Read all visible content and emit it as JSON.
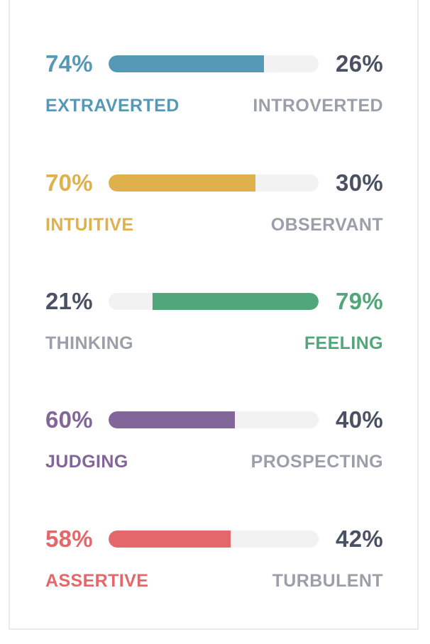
{
  "colors": {
    "neutral_text": "#4a5163",
    "neutral_label": "#9a9fa9",
    "track": "#f2f2f3",
    "card_border": "#e9eaec"
  },
  "traits": [
    {
      "left_percent": "74%",
      "right_percent": "26%",
      "left_label": "EXTRAVERTED",
      "right_label": "INTROVERTED",
      "dominant": "left",
      "fill_percent": 74,
      "color": "#5699b6"
    },
    {
      "left_percent": "70%",
      "right_percent": "30%",
      "left_label": "INTUITIVE",
      "right_label": "OBSERVANT",
      "dominant": "left",
      "fill_percent": 70,
      "color": "#dfb14d"
    },
    {
      "left_percent": "21%",
      "right_percent": "79%",
      "left_label": "THINKING",
      "right_label": "FEELING",
      "dominant": "right",
      "fill_percent": 79,
      "color": "#52a77a"
    },
    {
      "left_percent": "60%",
      "right_percent": "40%",
      "left_label": "JUDGING",
      "right_label": "PROSPECTING",
      "dominant": "left",
      "fill_percent": 60,
      "color": "#836699"
    },
    {
      "left_percent": "58%",
      "right_percent": "42%",
      "left_label": "ASSERTIVE",
      "right_label": "TURBULENT",
      "dominant": "left",
      "fill_percent": 58,
      "color": "#e3686a"
    }
  ]
}
